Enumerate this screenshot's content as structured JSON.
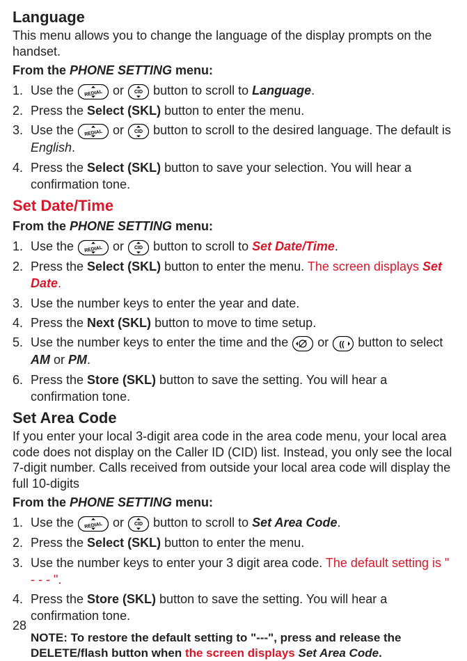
{
  "language": {
    "heading": "Language",
    "intro": "This menu allows you to change the language of the display prompts on the handset.",
    "menuline_pre": "From the ",
    "menuline_it": "PHONE SETTING",
    "menuline_post": " menu:",
    "steps": [
      {
        "num": "1.",
        "pre": "Use the ",
        "mid": " or ",
        "post": " button to scroll to ",
        "target": "Language",
        "end": "."
      },
      {
        "num": "2.",
        "pre": "Press the ",
        "skl": "Select (SKL)",
        "post": " button to enter the menu."
      },
      {
        "num": "3.",
        "pre": "Use the ",
        "mid": " or ",
        "post": " button to scroll to the desired language. The default is ",
        "target_it": "English",
        "end": "."
      },
      {
        "num": "4.",
        "pre": "Press the ",
        "skl": "Select (SKL)",
        "post": " button to save your selection. You will hear a confirmation tone."
      }
    ]
  },
  "datetime": {
    "heading": "Set Date/Time",
    "menuline_pre": "From the ",
    "menuline_it": "PHONE SETTING",
    "menuline_post": " menu:",
    "steps": [
      {
        "num": "1.",
        "pre": "Use the ",
        "mid": " or ",
        "post": " button to scroll to ",
        "target_red": "Set Date/Time",
        "end": "."
      },
      {
        "num": "2.",
        "pre": "Press the ",
        "skl": "Select (SKL)",
        "post": " button to enter the menu. ",
        "red_pre": "The screen displays ",
        "red_it": "Set Date",
        "red_end": "."
      },
      {
        "num": "3.",
        "text": "Use the number keys to enter the year and date."
      },
      {
        "num": "4.",
        "pre": "Press the ",
        "skl": "Next (SKL)",
        "post": " button to move to time setup."
      },
      {
        "num": "5.",
        "pre": "Use the number keys to enter the time and the ",
        "mid": " or ",
        "post": " button to select ",
        "am": "AM",
        "or": " or ",
        "pm": "PM",
        "end": "."
      },
      {
        "num": "6.",
        "pre": "Press the ",
        "skl": "Store (SKL)",
        "post": " button to save the setting. You will hear a confirmation tone."
      }
    ]
  },
  "areacode": {
    "heading": "Set Area Code",
    "intro": "If you enter your local 3-digit area code in the area code menu, your local area code does not display on the Caller ID (CID) list. Instead, you only see the local 7-digit number. Calls received from outside your local area code will display the full 10-digits",
    "menuline_pre": "From the ",
    "menuline_it": "PHONE SETTING",
    "menuline_post": " menu:",
    "steps": [
      {
        "num": "1.",
        "pre": "Use the ",
        "mid": " or ",
        "post": " button to scroll to ",
        "target": "Set Area Code",
        "end": "."
      },
      {
        "num": "2.",
        "pre": "Press the ",
        "skl": "Select (SKL)",
        "post": " button to enter the menu."
      },
      {
        "num": "3.",
        "pre": "Use the number keys to enter your 3 digit area code. ",
        "red": "The default setting  is \" - - - \"."
      },
      {
        "num": "4.",
        "pre": "Press the ",
        "skl": "Store (SKL)",
        "post": " button to save the setting. You will hear a confirmation tone."
      }
    ],
    "note_pre": "NOTE: To restore the default setting to \"---\", press and release the DELETE/flash button when ",
    "note_red": "the screen displays ",
    "note_it": "Set Area Code",
    "note_end": "."
  },
  "pagenum": "28"
}
